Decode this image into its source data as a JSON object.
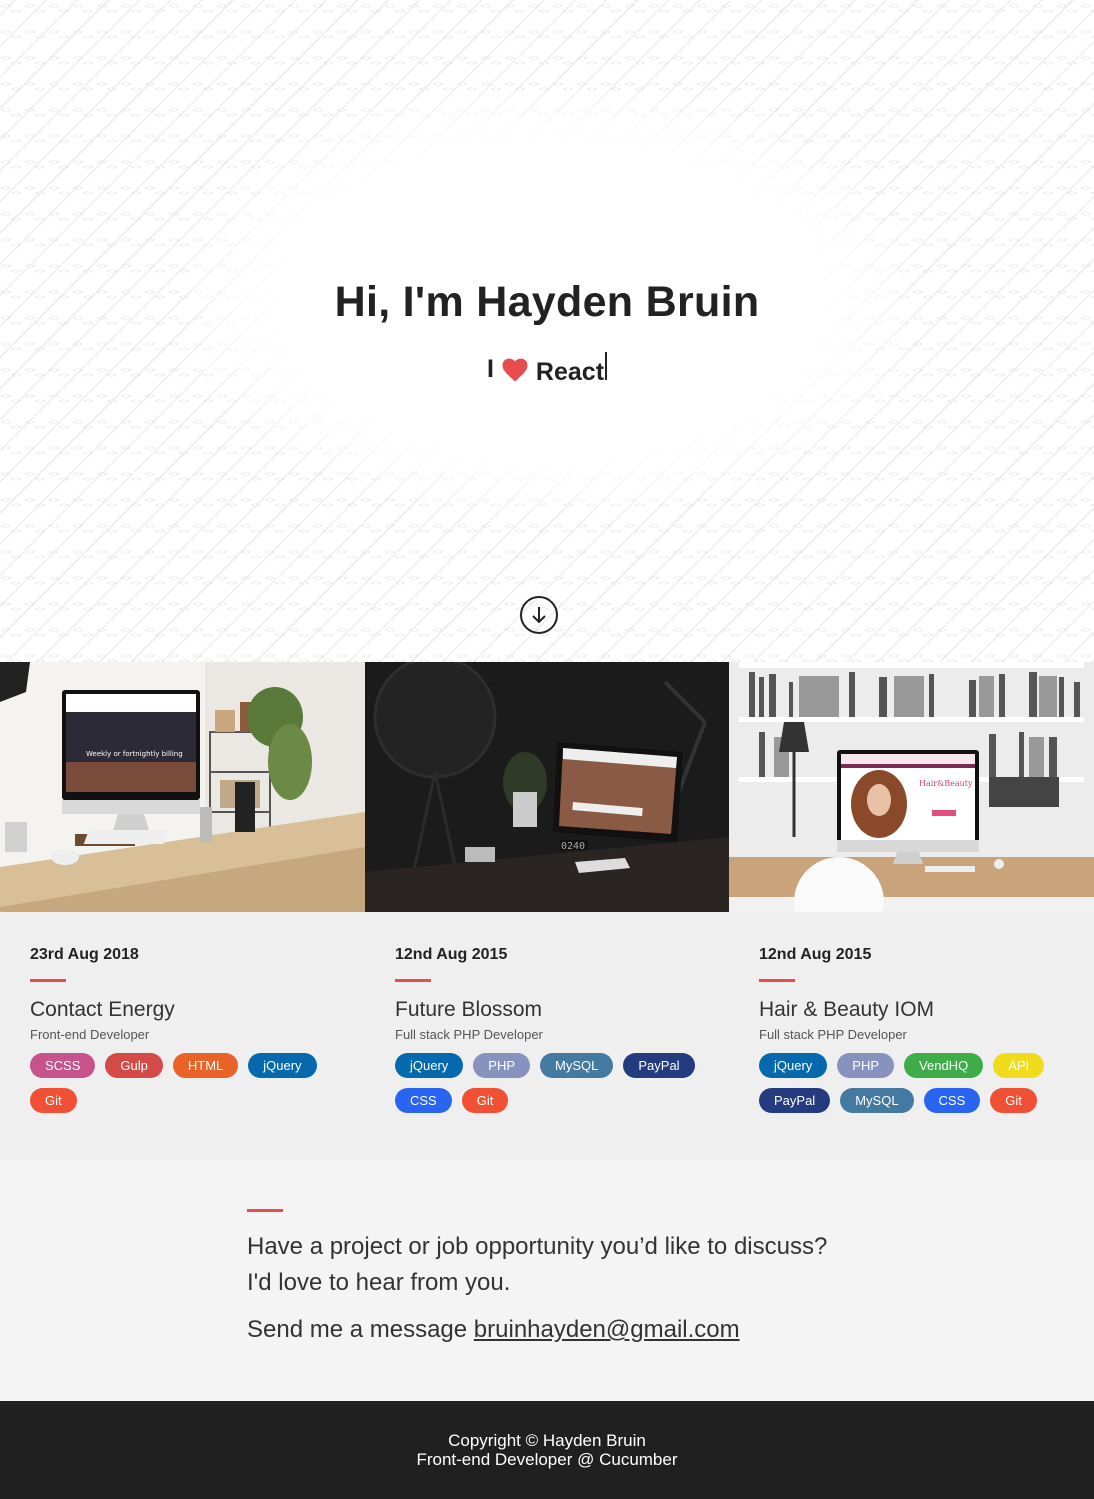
{
  "hero": {
    "title": "Hi, I'm Hayden Bruin",
    "sub_prefix": "I",
    "sub_word": "React",
    "heart_icon": "heart-icon",
    "scroll_icon": "arrow-down-circle-icon",
    "heart_color": "#e84c4c"
  },
  "projects": [
    {
      "date": "23rd Aug 2018",
      "title": "Contact Energy",
      "role": "Front-end Developer",
      "screen_text": "Weekly or fortnightly billing",
      "tags": [
        {
          "label": "SCSS",
          "color": "#c6538c"
        },
        {
          "label": "Gulp",
          "color": "#d34a47"
        },
        {
          "label": "HTML",
          "color": "#e96228"
        },
        {
          "label": "jQuery",
          "color": "#0769ad"
        },
        {
          "label": "Git",
          "color": "#f05033"
        }
      ]
    },
    {
      "date": "12nd Aug 2015",
      "title": "Future Blossom",
      "role": "Full stack PHP Developer",
      "screen_text": "0240",
      "tags": [
        {
          "label": "jQuery",
          "color": "#0769ad"
        },
        {
          "label": "PHP",
          "color": "#8892bf"
        },
        {
          "label": "MySQL",
          "color": "#4479a1"
        },
        {
          "label": "PayPal",
          "color": "#253b80"
        },
        {
          "label": "CSS",
          "color": "#2965f1"
        },
        {
          "label": "Git",
          "color": "#f05033"
        }
      ]
    },
    {
      "date": "12nd Aug 2015",
      "title": "Hair & Beauty IOM",
      "role": "Full stack PHP Developer",
      "screen_text": "Hair&Beauty",
      "tags": [
        {
          "label": "jQuery",
          "color": "#0769ad"
        },
        {
          "label": "PHP",
          "color": "#8892bf"
        },
        {
          "label": "VendHQ",
          "color": "#3ead48"
        },
        {
          "label": "API",
          "color": "#f0db1c"
        },
        {
          "label": "PayPal",
          "color": "#253b80"
        },
        {
          "label": "MySQL",
          "color": "#4479a1"
        },
        {
          "label": "CSS",
          "color": "#2965f1"
        },
        {
          "label": "Git",
          "color": "#f05033"
        }
      ]
    }
  ],
  "contact": {
    "text": "Have a project or job opportunity you’d like to discuss? I'd love to hear from you.",
    "message_prefix": "Send me a message",
    "email": "bruinhayden@gmail.com"
  },
  "footer": {
    "line1": "Copyright © Hayden Bruin",
    "line2": "Front-end Developer @ Cucumber"
  },
  "colors": {
    "accent": "#e84c4c",
    "footer_bg": "#202020",
    "projects_bg": "#efefef",
    "contact_bg": "#f4f4f4"
  }
}
